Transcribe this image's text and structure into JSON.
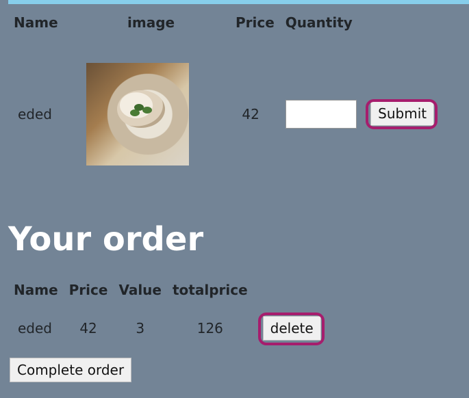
{
  "menu": {
    "headers": [
      "Name",
      "image",
      "Price",
      "Quantity"
    ],
    "rows": [
      {
        "name": "eded",
        "image_alt": "bowl of food",
        "price": "42",
        "quantity_value": "",
        "submit_label": "Submit"
      }
    ]
  },
  "order": {
    "title": "Your order",
    "headers": [
      "Name",
      "Price",
      "Value",
      "totalprice"
    ],
    "rows": [
      {
        "name": "eded",
        "price": "42",
        "value": "3",
        "totalprice": "126",
        "delete_label": "delete"
      }
    ],
    "complete_label": "Complete order"
  },
  "colors": {
    "background": "#738496",
    "top_bar": "#87ceeb",
    "highlight": "#a61d6d"
  }
}
